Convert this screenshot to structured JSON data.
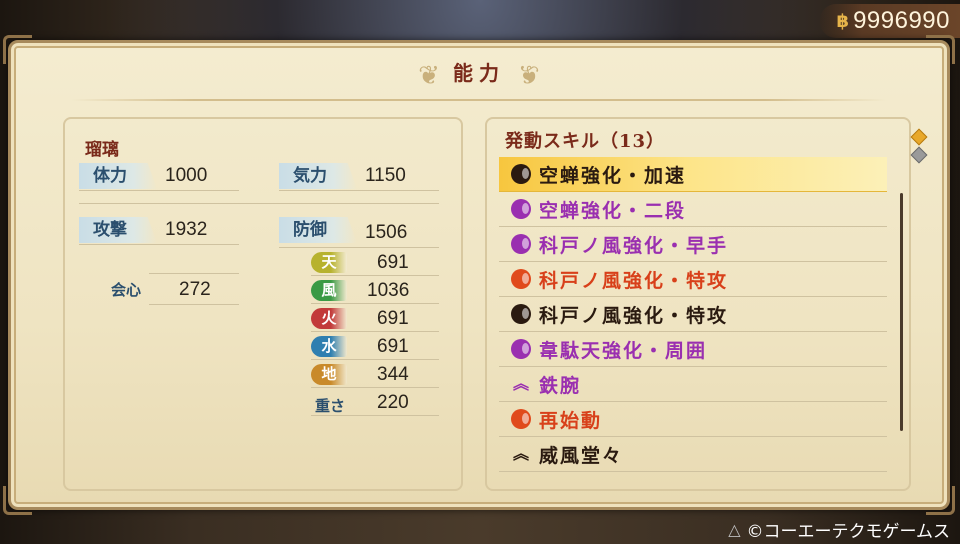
{
  "currency": {
    "icon": "coin-icon",
    "amount": "9996990"
  },
  "panel": {
    "title": "能力",
    "character": {
      "name": "瑠璃",
      "stats": {
        "hp_label": "体力",
        "hp": "1000",
        "ki_label": "気力",
        "ki": "1150",
        "atk_label": "攻撃",
        "atk": "1932",
        "def_label": "防御",
        "def": "1506",
        "crit_label": "会心",
        "crit": "272",
        "weight_label": "重さ",
        "weight": "220"
      },
      "elements": [
        {
          "label": "天",
          "value": "691",
          "color": "#b7b22e"
        },
        {
          "label": "風",
          "value": "1036",
          "color": "#3a9a45"
        },
        {
          "label": "火",
          "value": "691",
          "color": "#c23a3a"
        },
        {
          "label": "水",
          "value": "691",
          "color": "#2f7fb0"
        },
        {
          "label": "地",
          "value": "344",
          "color": "#c98a2a"
        }
      ]
    },
    "skills": {
      "title": "発動スキル（13）",
      "items": [
        {
          "name": "空蝉強化・加速",
          "icon": "dark-orb-icon",
          "color": "#2a1a10",
          "text_color": "#2a1a10"
        },
        {
          "name": "空蝉強化・二段",
          "icon": "purple-orb-icon",
          "color": "#9a2fb0",
          "text_color": "#9a2fb0"
        },
        {
          "name": "科戸ノ風強化・早手",
          "icon": "purple-orb-icon",
          "color": "#9a2fb0",
          "text_color": "#9a2fb0"
        },
        {
          "name": "科戸ノ風強化・特攻",
          "icon": "red-orb-icon",
          "color": "#e04a1c",
          "text_color": "#d8401a"
        },
        {
          "name": "科戸ノ風強化・特攻",
          "icon": "dark-orb-icon",
          "color": "#2a1a10",
          "text_color": "#2a1a10"
        },
        {
          "name": "韋駄天強化・周囲",
          "icon": "purple-orb-icon",
          "color": "#9a2fb0",
          "text_color": "#9a2fb0"
        },
        {
          "name": "鉄腕",
          "icon": "purple-chevron-icon",
          "color": "#9a2fb0",
          "text_color": "#9a2fb0"
        },
        {
          "name": "再始動",
          "icon": "red-orb-icon",
          "color": "#e04a1c",
          "text_color": "#d8401a"
        },
        {
          "name": "威風堂々",
          "icon": "dark-chevron-icon",
          "color": "#2a1a10",
          "text_color": "#2a1a10"
        }
      ]
    }
  },
  "footer": {
    "button": "△",
    "copyright": "©コーエーテクモゲームス"
  },
  "colors": {
    "accent": "#7a2a1a",
    "label": "#2b4f6e",
    "selected": "#f7c63e"
  }
}
